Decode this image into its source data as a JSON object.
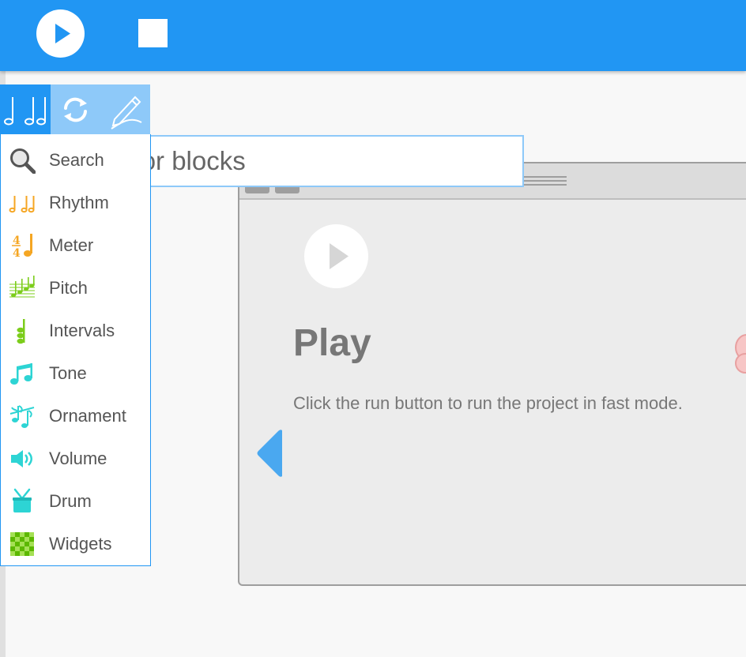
{
  "colors": {
    "toolbar": "#2196f3",
    "palette_tab_active": "#2196f3",
    "palette_tab_inactive": "#8ec9f9",
    "rhythm": "#f5a623",
    "pitch": "#7ccd1b",
    "tone": "#2dd4d4"
  },
  "toolbar": {
    "run_icon": "play-icon",
    "stop_icon": "stop-icon"
  },
  "palette_tabs": [
    {
      "icon": "music-notes-icon",
      "active": true
    },
    {
      "icon": "refresh-icon",
      "active": false
    },
    {
      "icon": "pencil-icon",
      "active": false
    }
  ],
  "palette": {
    "items": [
      {
        "label": "Search",
        "icon": "magnifier-icon"
      },
      {
        "label": "Rhythm",
        "icon": "rhythm-notes-icon"
      },
      {
        "label": "Meter",
        "icon": "time-signature-icon"
      },
      {
        "label": "Pitch",
        "icon": "pitch-staff-icon"
      },
      {
        "label": "Intervals",
        "icon": "intervals-note-icon"
      },
      {
        "label": "Tone",
        "icon": "tone-note-icon"
      },
      {
        "label": "Ornament",
        "icon": "ornament-notes-icon"
      },
      {
        "label": "Volume",
        "icon": "speaker-icon"
      },
      {
        "label": "Drum",
        "icon": "drum-icon"
      },
      {
        "label": "Widgets",
        "icon": "widget-grid-icon"
      }
    ]
  },
  "search": {
    "placeholder": "Search for blocks",
    "visible_text": "h for blocks"
  },
  "help": {
    "title": "Play",
    "body": "Click the run button to run the project in fast mode.",
    "icon": "play-circle-icon"
  }
}
